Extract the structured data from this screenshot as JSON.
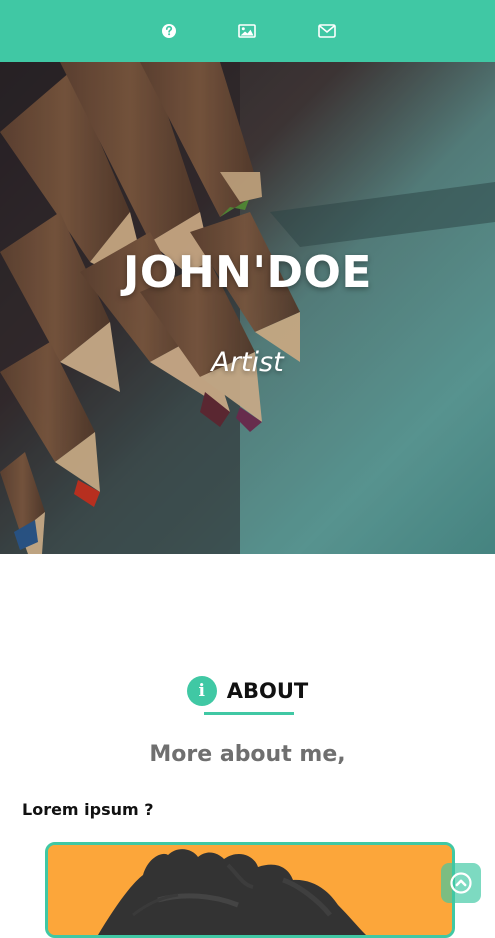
{
  "nav": {
    "items": [
      {
        "icon": "question-circle-icon"
      },
      {
        "icon": "image-icon"
      },
      {
        "icon": "envelope-icon"
      }
    ]
  },
  "hero": {
    "title": "JOHN'DOE",
    "subtitle": "Artist"
  },
  "about": {
    "icon": "info-icon",
    "icon_glyph": "i",
    "title": "ABOUT",
    "subtitle": "More about me,",
    "question": "Lorem ipsum ?"
  },
  "colors": {
    "accent": "#40c8a4",
    "card_background": "#fca63a",
    "heading": "#111111",
    "subtitle": "#6f6f6f"
  }
}
